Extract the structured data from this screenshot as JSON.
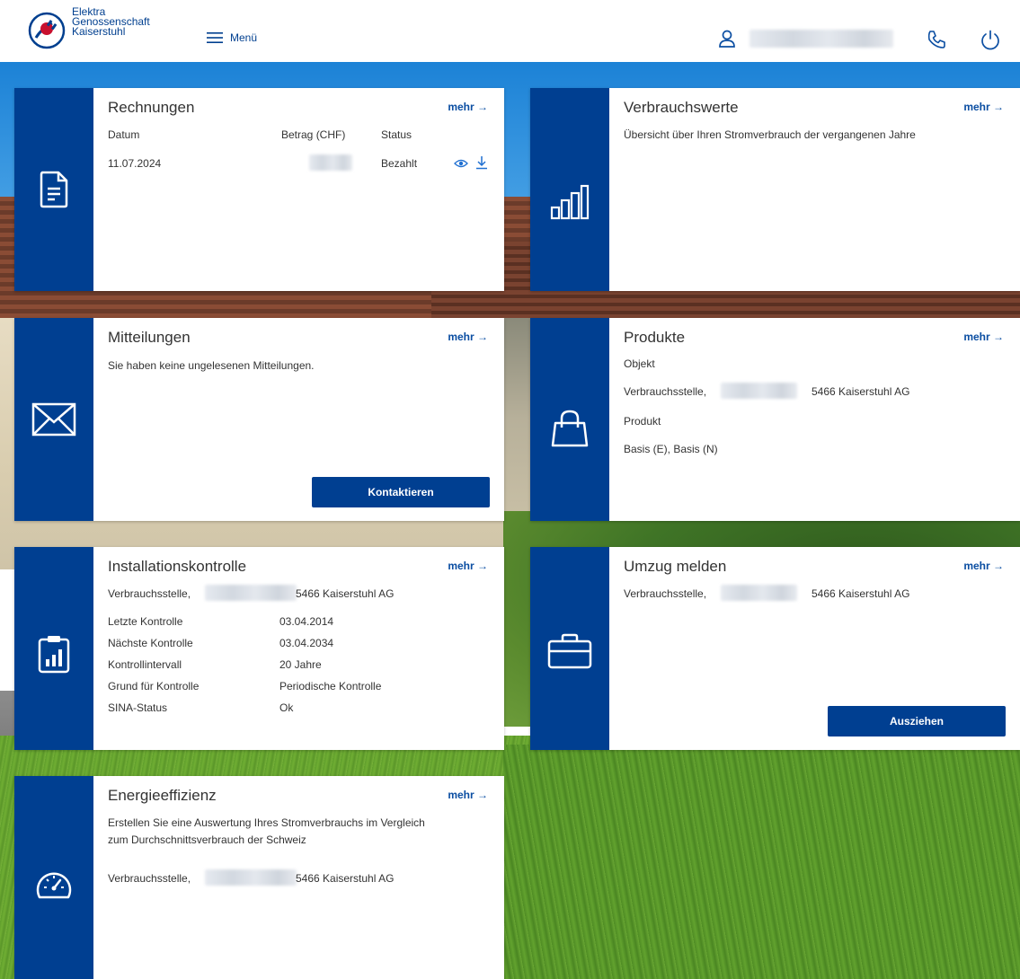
{
  "header": {
    "logo_line1": "Elektra",
    "logo_line2": "Genossenschaft",
    "logo_line3": "Kaiserstuhl",
    "menu_label": "Menü",
    "icons": [
      "user-icon",
      "phone-icon",
      "power-icon"
    ]
  },
  "common": {
    "more_label": "mehr →"
  },
  "rechnungen": {
    "title": "Rechnungen",
    "columns": [
      "Datum",
      "Betrag (CHF)",
      "Status"
    ],
    "rows": [
      {
        "date": "11.07.2024",
        "status": "Bezahlt"
      }
    ]
  },
  "verbrauchswerte": {
    "title": "Verbrauchswerte",
    "text": "Übersicht über Ihren Stromverbrauch der vergangenen Jahre"
  },
  "mitteilungen": {
    "title": "Mitteilungen",
    "text": "Sie haben keine ungelesenen Mitteilungen.",
    "button": "Kontaktieren"
  },
  "produkte": {
    "title": "Produkte",
    "object_label": "Objekt",
    "location_prefix": "Verbrauchsstelle,",
    "location_suffix": "5466 Kaiserstuhl AG",
    "product_label": "Produkt",
    "product_value": "Basis (E), Basis (N)"
  },
  "installationskontrolle": {
    "title": "Installationskontrolle",
    "location_prefix": "Verbrauchsstelle,",
    "location_suffix": "5466 Kaiserstuhl AG",
    "details": [
      {
        "label": "Letzte Kontrolle",
        "value": "03.04.2014"
      },
      {
        "label": "Nächste Kontrolle",
        "value": "03.04.2034"
      },
      {
        "label": "Kontrollintervall",
        "value": "20 Jahre"
      },
      {
        "label": "Grund für Kontrolle",
        "value": "Periodische Kontrolle"
      },
      {
        "label": "SINA-Status",
        "value": "Ok"
      }
    ]
  },
  "umzug": {
    "title": "Umzug melden",
    "location_prefix": "Verbrauchsstelle,",
    "location_suffix": "5466 Kaiserstuhl AG",
    "button": "Ausziehen"
  },
  "energieeffizienz": {
    "title": "Energieeffizienz",
    "text_line1": "Erstellen Sie eine Auswertung Ihres Stromverbrauchs im Vergleich",
    "text_line2": "zum Durchschnittsverbrauch der Schweiz",
    "location_prefix": "Verbrauchsstelle,",
    "location_suffix": "5466 Kaiserstuhl AG"
  },
  "colors": {
    "primary": "#003f91",
    "link": "#0b4ea2"
  }
}
